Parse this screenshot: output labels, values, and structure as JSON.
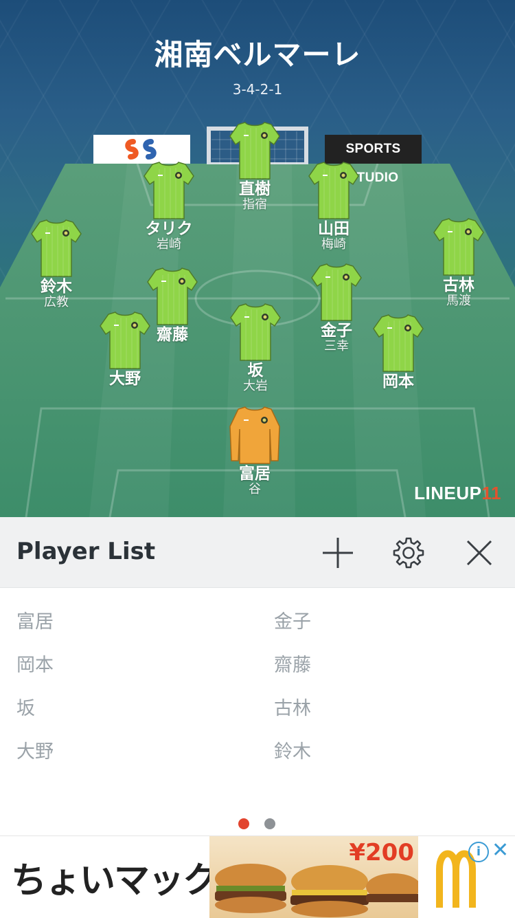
{
  "team": {
    "name": "湘南ベルマーレ",
    "formation": "3-4-2-1"
  },
  "sponsors": {
    "studio": "SPORTS STUDIO"
  },
  "branding": {
    "logo_text": "LINEUP",
    "logo_num": "11"
  },
  "players": [
    {
      "main": "直樹",
      "sub": "指宿"
    },
    {
      "main": "タリク",
      "sub": "岩崎"
    },
    {
      "main": "山田",
      "sub": "梅崎"
    },
    {
      "main": "鈴木",
      "sub": "広教"
    },
    {
      "main": "古林",
      "sub": "馬渡"
    },
    {
      "main": "齋藤",
      "sub": ""
    },
    {
      "main": "金子",
      "sub": "三幸"
    },
    {
      "main": "大野",
      "sub": ""
    },
    {
      "main": "坂",
      "sub": "大岩"
    },
    {
      "main": "岡本",
      "sub": ""
    },
    {
      "main": "富居",
      "sub": "谷"
    }
  ],
  "player_list": {
    "title": "Player List",
    "left": [
      "富居",
      "岡本",
      "坂",
      "大野"
    ],
    "right": [
      "金子",
      "齋藤",
      "古林",
      "鈴木"
    ]
  },
  "pager": {
    "active_color": "#e2442e",
    "inactive_color": "#8e9296"
  },
  "ad": {
    "text": "ちょいマック",
    "price": "¥200"
  },
  "colors": {
    "kit_field": "#8fd548",
    "kit_keeper": "#f0a53a"
  }
}
